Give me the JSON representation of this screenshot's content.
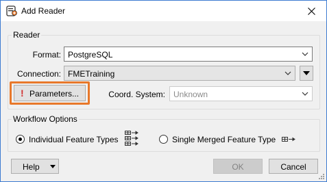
{
  "window": {
    "title": "Add Reader",
    "close_icon": "close-icon"
  },
  "reader": {
    "group_label": "Reader",
    "format_label": "Format:",
    "format_value": "PostgreSQL",
    "connection_label": "Connection:",
    "connection_value": "FMETraining",
    "parameters_label": "Parameters...",
    "parameters_warning": "!",
    "coord_label": "Coord. System:",
    "coord_value": "Unknown"
  },
  "workflow": {
    "group_label": "Workflow Options",
    "option_individual": "Individual Feature Types",
    "option_merged": "Single Merged Feature Type",
    "selected": "individual"
  },
  "footer": {
    "help_label": "Help",
    "ok_label": "OK",
    "cancel_label": "Cancel"
  },
  "colors": {
    "highlight": "#e8782a",
    "warning": "#d12f2f",
    "accent": "#3d7bd1"
  }
}
